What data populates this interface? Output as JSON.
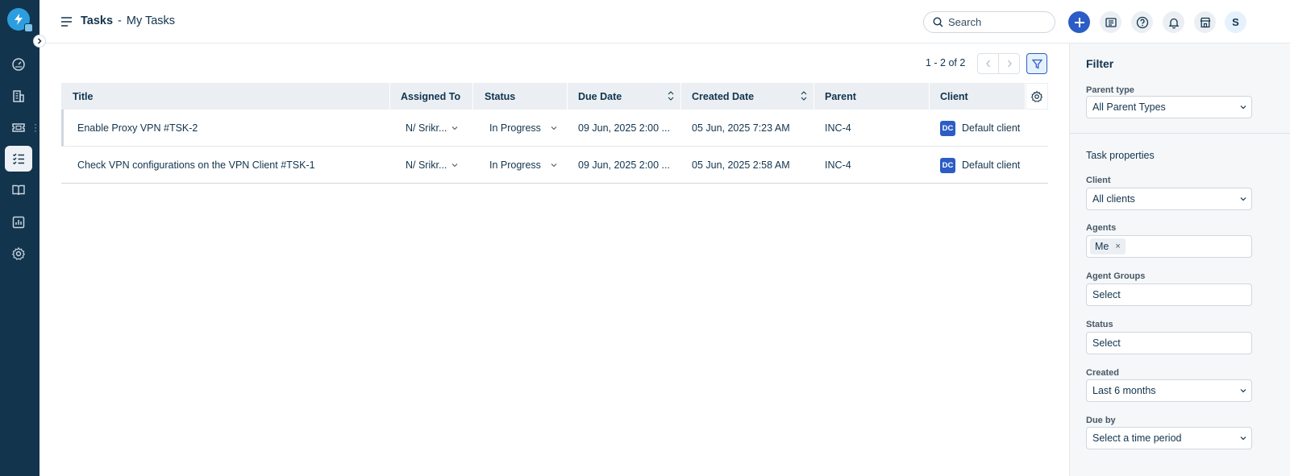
{
  "header": {
    "title": "Tasks",
    "separator": "-",
    "subtitle": "My Tasks",
    "search_placeholder": "Search",
    "avatar_initial": "S"
  },
  "pagination": {
    "summary": "1 - 2 of 2"
  },
  "table": {
    "columns": [
      "Title",
      "Assigned To",
      "Status",
      "Due Date",
      "Created Date",
      "Parent",
      "Client"
    ],
    "rows": [
      {
        "title": "Enable Proxy VPN  #TSK-2",
        "assigned_to": "N/ Srikr...",
        "status": "In Progress",
        "due_date": "09 Jun, 2025 2:00 ...",
        "created_date": "05 Jun, 2025 7:23 AM",
        "parent": "INC-4",
        "client_badge": "DC",
        "client": "Default client"
      },
      {
        "title": "Check VPN configurations on the VPN Client  #TSK-1",
        "assigned_to": "N/ Srikr...",
        "status": "In Progress",
        "due_date": "09 Jun, 2025 2:00 ...",
        "created_date": "05 Jun, 2025 2:58 AM",
        "parent": "INC-4",
        "client_badge": "DC",
        "client": "Default client"
      }
    ]
  },
  "filter": {
    "title": "Filter",
    "parent_type_label": "Parent type",
    "parent_type_value": "All Parent Types",
    "section_title": "Task properties",
    "client_label": "Client",
    "client_value": "All clients",
    "agents_label": "Agents",
    "agents_chip": "Me",
    "agents_chip_remove": "×",
    "agent_groups_label": "Agent Groups",
    "agent_groups_value": "Select",
    "status_label": "Status",
    "status_value": "Select",
    "created_label": "Created",
    "created_value": "Last 6 months",
    "due_by_label": "Due by",
    "due_by_value": "Select a time period"
  },
  "colors": {
    "rail_bg": "#12344d",
    "accent": "#2c5cc5",
    "header_bg": "#ebeff3",
    "panel_bg": "#f5f7f9"
  }
}
